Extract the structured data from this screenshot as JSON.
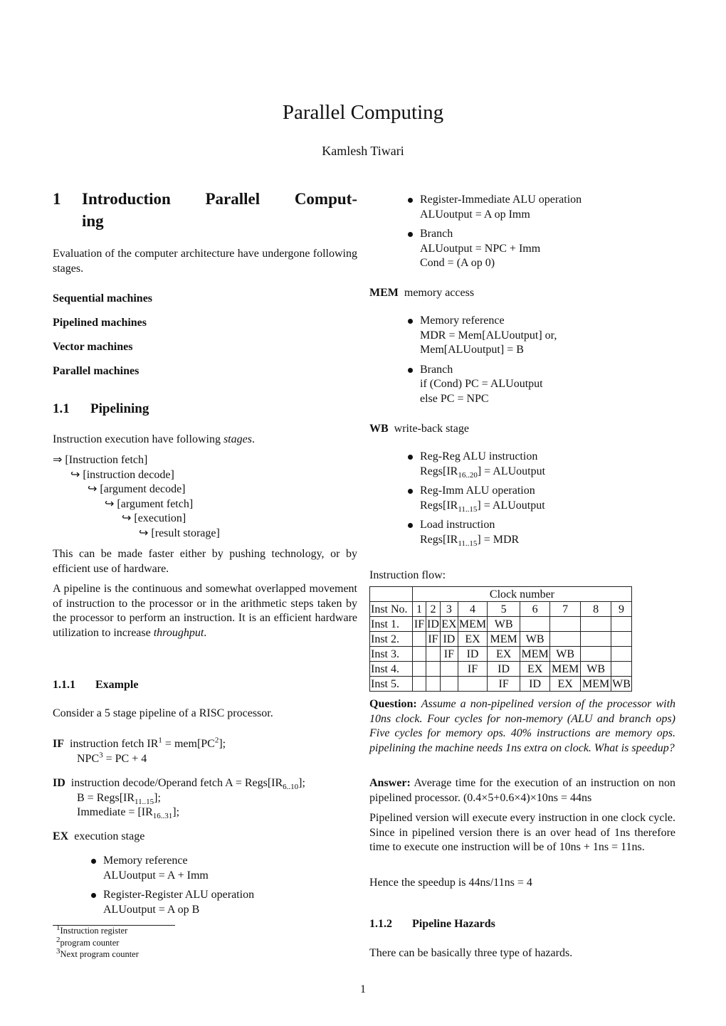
{
  "document": {
    "title": "Parallel Computing",
    "author": "Kamlesh Tiwari",
    "page_number": "1"
  },
  "section1": {
    "number": "1",
    "title": "Introduction Parallel Comput-ing",
    "title_line1": "Introduction Parallel Comput-",
    "title_line2": "ing",
    "intro": "Evaluation of the computer architecture have undergone following stages.",
    "stages_list": [
      "Sequential machines",
      "Pipelined machines",
      "Vector machines",
      "Parallel machines"
    ]
  },
  "section1_1": {
    "number": "1.1",
    "title": "Pipelining",
    "intro_prefix": "Instruction execution have following ",
    "intro_emph": "stages",
    "intro_suffix": ".",
    "stage_chain": [
      {
        "arrow": "⇒",
        "label": "[Instruction fetch]"
      },
      {
        "arrow": "↪",
        "label": "[instruction decode]"
      },
      {
        "arrow": "↪",
        "label": "[argument decode]"
      },
      {
        "arrow": "↪",
        "label": "[argument fetch]"
      },
      {
        "arrow": "↪",
        "label": "[execution]"
      },
      {
        "arrow": "↪",
        "label": "[result storage]"
      }
    ],
    "faster": "This can be made faster either by pushing technology, or by efficient use of hardware.",
    "pipeline_def": "A pipeline is the continuous and somewhat overlapped movement of instruction to the processor or in the arithmetic steps taken by the processor to perform an instruction.  It is an efficient hardware utilization to increase ",
    "pipeline_def_emph": "throughput",
    "pipeline_def_end": "."
  },
  "section1_1_1": {
    "number": "1.1.1",
    "title": "Example",
    "intro": "Consider a 5 stage pipeline of a RISC processor.",
    "IF": {
      "label": "IF",
      "line1_a": "instruction fetch IR",
      "line1_sup1": "1",
      "line1_b": " = mem[PC",
      "line1_sup2": "2",
      "line1_c": "];",
      "line2_a": "NPC",
      "line2_sup": "3",
      "line2_b": " = PC + 4"
    },
    "ID": {
      "label": "ID",
      "line1_a": "instruction decode/Operand fetch A = Regs[IR",
      "line1_sub": "6..10",
      "line1_b": "];",
      "line2_a": "B = Regs[IR",
      "line2_sub": "11..15",
      "line2_b": "];",
      "line3_a": "Immediate = [IR",
      "line3_sub": "16..31",
      "line3_b": "];"
    },
    "EX": {
      "label": "EX",
      "desc": "execution stage",
      "items": [
        {
          "name": "Memory reference",
          "formula": "ALUoutput = A + Imm"
        },
        {
          "name": "Register-Register ALU operation",
          "formula": "ALUoutput = A op B"
        },
        {
          "name": "Register-Immediate ALU operation",
          "formula": "ALUoutput = A op Imm"
        },
        {
          "name": "Branch",
          "formula": "ALUoutput = NPC + Imm",
          "formula2": "Cond = (A op 0)"
        }
      ]
    },
    "MEM": {
      "label": "MEM",
      "desc": "memory access",
      "items": [
        {
          "name": "Memory reference",
          "formula": "MDR = Mem[ALUoutput] or,",
          "formula2": "Mem[ALUoutput] = B"
        },
        {
          "name": "Branch",
          "formula": "if (Cond) PC = ALUoutput",
          "formula2": "else PC = NPC"
        }
      ]
    },
    "WB": {
      "label": "WB",
      "desc": "write-back stage",
      "items": [
        {
          "name": "Reg-Reg ALU instruction",
          "f_a": "Regs[IR",
          "f_sub": "16..20",
          "f_b": "] = ALUoutput"
        },
        {
          "name": "Reg-Imm ALU operation",
          "f_a": "Regs[IR",
          "f_sub": "11..15",
          "f_b": "] = ALUoutput"
        },
        {
          "name": "Load instruction",
          "f_a": "Regs[IR",
          "f_sub": "11..15",
          "f_b": "] = MDR"
        }
      ]
    },
    "flow_label": "Instruction flow:",
    "flow_table": {
      "group_header": "Clock number",
      "row_header": "Inst No.",
      "clocks": [
        "1",
        "2",
        "3",
        "4",
        "5",
        "6",
        "7",
        "8",
        "9"
      ],
      "rows": [
        {
          "inst": "Inst 1.",
          "cells": [
            "IF",
            "ID",
            "EX",
            "MEM",
            "WB",
            "",
            "",
            "",
            ""
          ]
        },
        {
          "inst": "Inst 2.",
          "cells": [
            "",
            "IF",
            "ID",
            "EX",
            "MEM",
            "WB",
            "",
            "",
            ""
          ]
        },
        {
          "inst": "Inst 3.",
          "cells": [
            "",
            "",
            "IF",
            "ID",
            "EX",
            "MEM",
            "WB",
            "",
            ""
          ]
        },
        {
          "inst": "Inst 4.",
          "cells": [
            "",
            "",
            "",
            "IF",
            "ID",
            "EX",
            "MEM",
            "WB",
            ""
          ]
        },
        {
          "inst": "Inst 5.",
          "cells": [
            "",
            "",
            "",
            "",
            "IF",
            "ID",
            "EX",
            "MEM",
            "WB"
          ]
        }
      ]
    },
    "question_label": "Question:",
    "question": "Assume a non-pipelined version of the processor with 10ns clock.  Four cycles for non-memory (ALU and branch ops) Five cycles for memory ops.  40% instructions are memory ops.  pipelining the machine needs 1ns extra on clock.  What is speedup?",
    "answer_label": "Answer:",
    "answer": "Average time for the execution of an instruction on non pipelined processor.  (0.4×5+0.6×4)×10ns = 44ns",
    "pipelined_text": "Pipelined version will execute every instruction in one clock cycle.  Since in pipelined version there is an over head of 1ns therefore time to execute one instruction will be of 10ns + 1ns = 11ns.",
    "speedup": "Hence the speedup is 44ns/11ns = 4"
  },
  "section1_1_2": {
    "number": "1.1.2",
    "title": "Pipeline Hazards",
    "intro": "There can be basically three type of hazards."
  },
  "footnotes": [
    {
      "mark": "1",
      "text": "Instruction register"
    },
    {
      "mark": "2",
      "text": "program counter"
    },
    {
      "mark": "3",
      "text": "Next program counter"
    }
  ]
}
